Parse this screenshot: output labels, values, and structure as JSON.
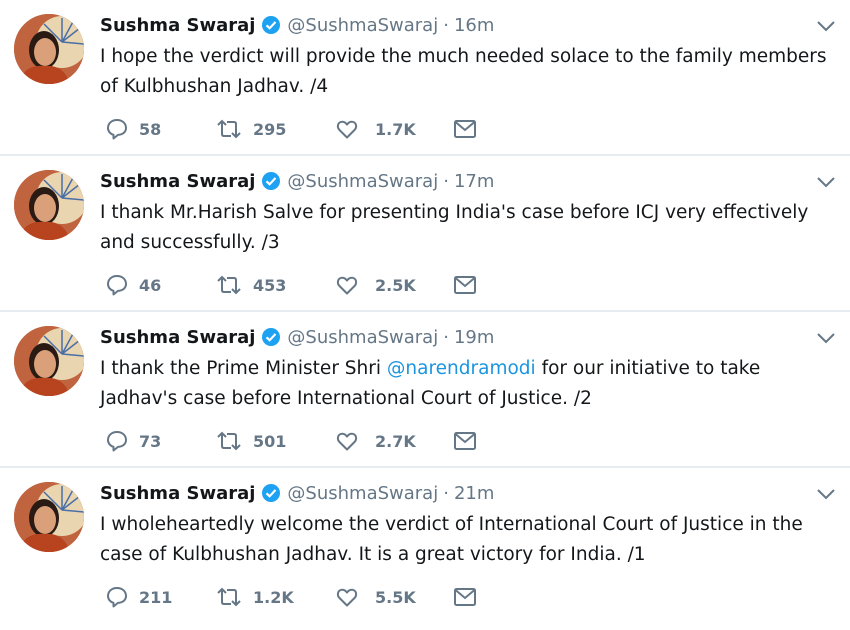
{
  "colors": {
    "name": "#14171a",
    "muted": "#657786",
    "link": "#1b95e0",
    "verified": "#1da1f2",
    "divider": "#e6ecf0"
  },
  "icons": {
    "reply": "reply-icon",
    "retweet": "retweet-icon",
    "like": "heart-icon",
    "dm": "envelope-icon",
    "verified": "verified-badge-icon",
    "menu": "chevron-down-icon"
  },
  "tweets": [
    {
      "name": "Sushma Swaraj",
      "handle": "@SushmaSwaraj",
      "separator": "·",
      "time": "16m",
      "text_before": "I hope the verdict will provide the much needed solace to the family members of Kulbhushan Jadhav. /4",
      "mention": "",
      "text_after": "",
      "replies": "58",
      "retweets": "295",
      "likes": "1.7K"
    },
    {
      "name": "Sushma Swaraj",
      "handle": "@SushmaSwaraj",
      "separator": "·",
      "time": "17m",
      "text_before": "I thank Mr.Harish Salve for presenting India's case before ICJ very effectively and successfully. /3",
      "mention": "",
      "text_after": "",
      "replies": "46",
      "retweets": "453",
      "likes": "2.5K"
    },
    {
      "name": "Sushma Swaraj",
      "handle": "@SushmaSwaraj",
      "separator": "·",
      "time": "19m",
      "text_before": "I thank the Prime Minister Shri ",
      "mention": "@narendramodi",
      "text_after": " for our initiative to take Jadhav's case before International Court of Justice. /2",
      "replies": "73",
      "retweets": "501",
      "likes": "2.7K"
    },
    {
      "name": "Sushma Swaraj",
      "handle": "@SushmaSwaraj",
      "separator": "·",
      "time": "21m",
      "text_before": "I wholeheartedly welcome the verdict of International Court of Justice in the case of Kulbhushan Jadhav. It is a great victory for India. /1",
      "mention": "",
      "text_after": "",
      "replies": "211",
      "retweets": "1.2K",
      "likes": "5.5K"
    }
  ]
}
